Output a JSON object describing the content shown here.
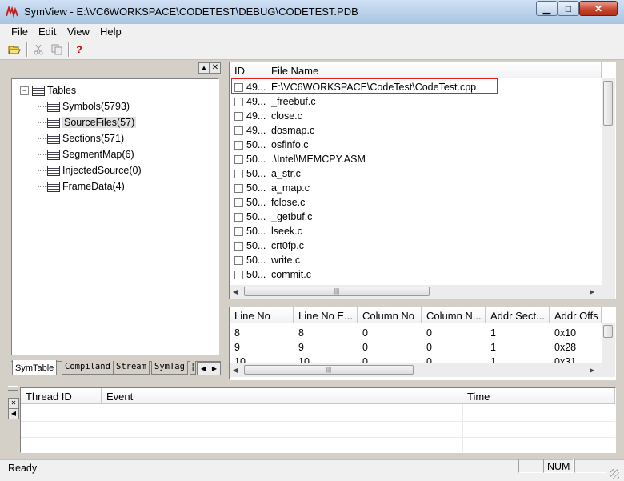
{
  "window": {
    "app_name": "SymView",
    "title": "SymView  -  E:\\VC6WORKSPACE\\CODETEST\\DEBUG\\CODETEST.PDB"
  },
  "menu": [
    "File",
    "Edit",
    "View",
    "Help"
  ],
  "toolbar": {
    "icons": [
      "open-folder-icon",
      "cut-icon",
      "copy-icon",
      "help-icon"
    ],
    "help_glyph": "?"
  },
  "tree": {
    "root": "Tables",
    "items": [
      "Symbols(5793)",
      "SourceFiles(57)",
      "Sections(571)",
      "SegmentMap(6)",
      "InjectedSource(0)",
      "FrameData(4)"
    ],
    "selected": "SourceFiles(57)"
  },
  "tabs": [
    "SymTable",
    "Compiland",
    "Stream",
    "SymTag",
    "¦"
  ],
  "files": {
    "columns": [
      "ID",
      "File Name"
    ],
    "rows": [
      {
        "id": "49...",
        "name": "E:\\VC6WORKSPACE\\CodeTest\\CodeTest.cpp"
      },
      {
        "id": "49...",
        "name": "_freebuf.c"
      },
      {
        "id": "49...",
        "name": "close.c"
      },
      {
        "id": "49...",
        "name": "dosmap.c"
      },
      {
        "id": "50...",
        "name": "osfinfo.c"
      },
      {
        "id": "50...",
        "name": ".\\Intel\\MEMCPY.ASM"
      },
      {
        "id": "50...",
        "name": "a_str.c"
      },
      {
        "id": "50...",
        "name": "a_map.c"
      },
      {
        "id": "50...",
        "name": "fclose.c"
      },
      {
        "id": "50...",
        "name": "_getbuf.c"
      },
      {
        "id": "50...",
        "name": "lseek.c"
      },
      {
        "id": "50...",
        "name": "crt0fp.c"
      },
      {
        "id": "50...",
        "name": "write.c"
      },
      {
        "id": "50...",
        "name": "commit.c"
      }
    ],
    "highlight_color": "#e02020"
  },
  "lines": {
    "columns": [
      "Line No",
      "Line No E...",
      "Column No",
      "Column N...",
      "Addr Sect...",
      "Addr Offs"
    ],
    "rows": [
      [
        "8",
        "8",
        "0",
        "0",
        "1",
        "0x10"
      ],
      [
        "9",
        "9",
        "0",
        "0",
        "1",
        "0x28"
      ],
      [
        "10",
        "10",
        "0",
        "0",
        "1",
        "0x31"
      ]
    ]
  },
  "events": {
    "columns": [
      "Thread ID",
      "Event",
      "Time"
    ]
  },
  "status": {
    "text": "Ready",
    "num": "NUM"
  }
}
